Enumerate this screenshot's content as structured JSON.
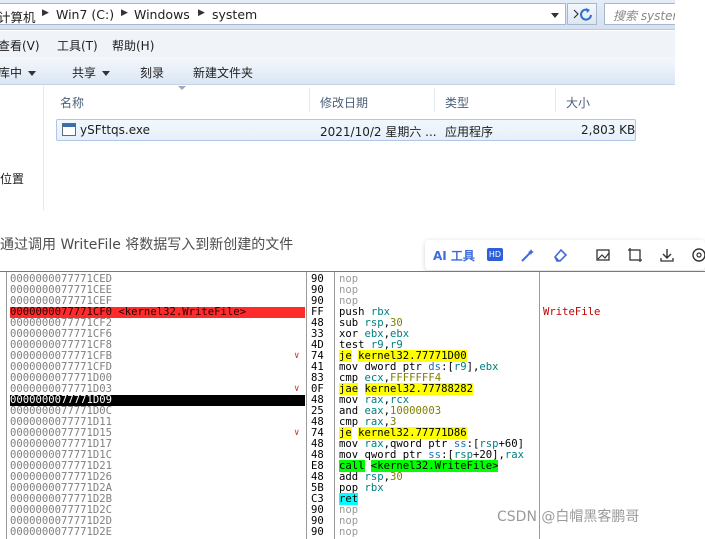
{
  "explorer": {
    "breadcrumb": [
      "计算机",
      "Win7 (C:)",
      "Windows",
      "system"
    ],
    "search_placeholder": "搜索 system",
    "menu": [
      "查看(V)",
      "工具(T)",
      "帮助(H)"
    ],
    "toolbar": [
      "刻库中",
      "共享",
      "刻录",
      "新建文件夹"
    ],
    "nav_item": "位置",
    "columns": [
      "名称",
      "修改日期",
      "类型",
      "大小"
    ],
    "file": {
      "name": "ySFttqs.exe",
      "date": "2021/10/2 星期六 ...",
      "type": "应用程序",
      "size": "2,803 KB"
    }
  },
  "caption": "通过调用 WriteFile 将数据写入到新创建的文件",
  "ai_toolbar": {
    "label": "AI 工具",
    "hd": "HD"
  },
  "debugger": {
    "rows": [
      {
        "addr": "0000000077771CED",
        "bytes": "90",
        "instr": "nop"
      },
      {
        "addr": "0000000077771CEE",
        "bytes": "90",
        "instr": "nop"
      },
      {
        "addr": "0000000077771CEF",
        "bytes": "90",
        "instr": "nop"
      },
      {
        "addr": "0000000077771CF0 <kernel32.WriteFile>",
        "bytes": "FF",
        "instr": "push rbx",
        "comment": "WriteFile"
      },
      {
        "addr": "0000000077771CF2",
        "bytes": "48",
        "instr": "sub rsp,30"
      },
      {
        "addr": "0000000077771CF6",
        "bytes": "33",
        "instr": "xor ebx,ebx"
      },
      {
        "addr": "0000000077771CF8",
        "bytes": "4D",
        "instr": "test r9,r9"
      },
      {
        "addr": "0000000077771CFB",
        "bytes": "74",
        "instr": "je kernel32.77771D00"
      },
      {
        "addr": "0000000077771CFD",
        "bytes": "41",
        "instr": "mov dword ptr ds:[r9],ebx"
      },
      {
        "addr": "0000000077771D00",
        "bytes": "83",
        "instr": "cmp ecx,FFFFFFF4"
      },
      {
        "addr": "0000000077771D03",
        "bytes": "0F",
        "instr": "jae kernel32.77788282"
      },
      {
        "addr": "0000000077771D09",
        "bytes": "48",
        "instr": "mov rax,rcx"
      },
      {
        "addr": "0000000077771D0C",
        "bytes": "25",
        "instr": "and eax,10000003"
      },
      {
        "addr": "0000000077771D11",
        "bytes": "48",
        "instr": "cmp rax,3"
      },
      {
        "addr": "0000000077771D15",
        "bytes": "74",
        "instr": "je kernel32.77771D86"
      },
      {
        "addr": "0000000077771D17",
        "bytes": "48",
        "instr": "mov rax,qword ptr ss:[rsp+60]"
      },
      {
        "addr": "0000000077771D1C",
        "bytes": "48",
        "instr": "mov qword ptr ss:[rsp+20],rax"
      },
      {
        "addr": "0000000077771D21",
        "bytes": "E8",
        "instr": "call <kernel32.WriteFile>"
      },
      {
        "addr": "0000000077771D26",
        "bytes": "48",
        "instr": "add rsp,30"
      },
      {
        "addr": "0000000077771D2A",
        "bytes": "5B",
        "instr": "pop rbx"
      },
      {
        "addr": "0000000077771D2B",
        "bytes": "C3",
        "instr": "ret"
      },
      {
        "addr": "0000000077771D2C",
        "bytes": "90",
        "instr": "nop"
      },
      {
        "addr": "0000000077771D2D",
        "bytes": "90",
        "instr": "nop"
      },
      {
        "addr": "0000000077771D2E",
        "bytes": "90",
        "instr": "nop"
      }
    ]
  },
  "watermark": "CSDN @白帽黑客鹏哥",
  "colors": {
    "highlight_red": "#ff2a2a",
    "jump_yellow": "#ffff00",
    "call_green": "#00ff00",
    "ret_cyan": "#00ffff",
    "link_blue": "#3d6ae0"
  }
}
